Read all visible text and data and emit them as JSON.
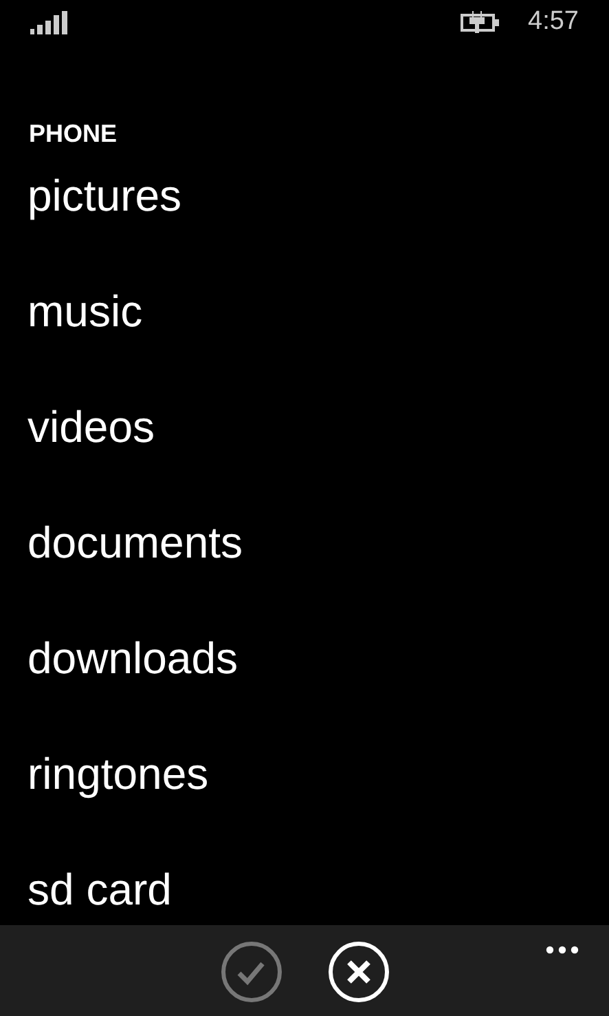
{
  "status_bar": {
    "time": "4:57"
  },
  "header": "PHONE",
  "items": [
    {
      "label": "pictures"
    },
    {
      "label": "music"
    },
    {
      "label": "videos"
    },
    {
      "label": "documents"
    },
    {
      "label": "downloads"
    },
    {
      "label": "ringtones"
    },
    {
      "label": "sd card"
    }
  ],
  "app_bar": {
    "buttons": [
      {
        "kind": "check",
        "disabled": true
      },
      {
        "kind": "close",
        "disabled": false
      }
    ]
  }
}
